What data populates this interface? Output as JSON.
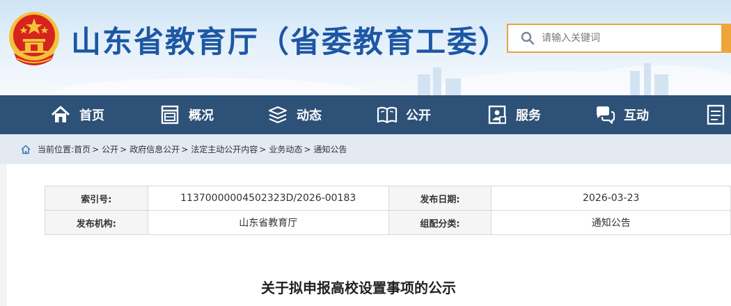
{
  "header": {
    "site_title": "山东省教育厅（省委教育工委）",
    "search": {
      "placeholder": "请输入关键词"
    }
  },
  "nav": {
    "items": [
      {
        "label": "首页",
        "icon": "home-icon"
      },
      {
        "label": "概况",
        "icon": "overview-icon"
      },
      {
        "label": "动态",
        "icon": "news-stack-icon"
      },
      {
        "label": "公开",
        "icon": "open-book-icon"
      },
      {
        "label": "服务",
        "icon": "service-icon"
      },
      {
        "label": "互动",
        "icon": "chat-icon"
      },
      {
        "label": "",
        "icon": "document-icon"
      }
    ]
  },
  "breadcrumb": {
    "prefix": "当前位置:",
    "items": [
      "首页",
      "公开",
      "政府信息公开",
      "法定主动公开内容",
      "业务动态",
      "通知公告"
    ]
  },
  "meta": {
    "index_label": "索引号:",
    "index_value": "11370000004502323D/2026-00183",
    "date_label": "发布日期:",
    "date_value": "2026-03-23",
    "org_label": "发布机构:",
    "org_value": "山东省教育厅",
    "category_label": "组配分类:",
    "category_value": "通知公告"
  },
  "article": {
    "title": "关于拟申报高校设置事项的公示"
  },
  "colors": {
    "nav_bg": "#2d5177",
    "title_blue": "#1d57a4",
    "search_accent": "#eea63b",
    "emblem_red": "#d7231d",
    "emblem_gold": "#f3c23a"
  }
}
